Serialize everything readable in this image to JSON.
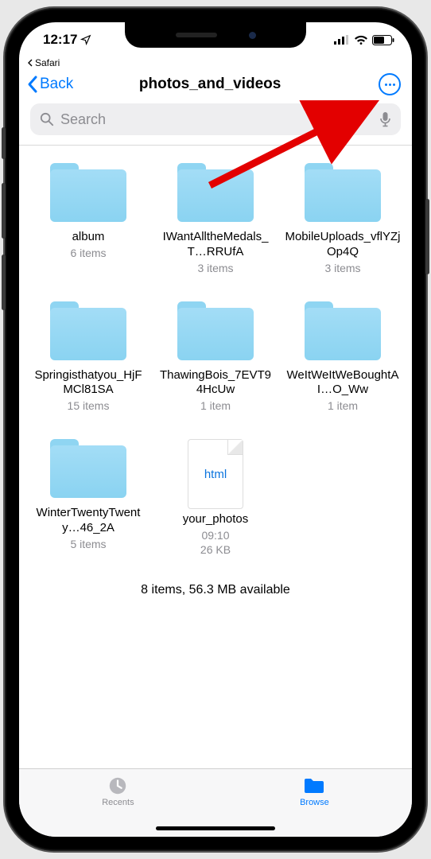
{
  "status": {
    "time": "12:17",
    "back_app": "Safari"
  },
  "nav": {
    "back_label": "Back",
    "title": "photos_and_videos"
  },
  "search": {
    "placeholder": "Search"
  },
  "items": [
    {
      "name": "album",
      "sub": "6 items",
      "type": "folder"
    },
    {
      "name": "IWantAlltheMedals_T…RRUfA",
      "sub": "3 items",
      "type": "folder"
    },
    {
      "name": "MobileUploads_vflYZjOp4Q",
      "sub": "3 items",
      "type": "folder"
    },
    {
      "name": "Springisthatyou_HjFMCl81SA",
      "sub": "15 items",
      "type": "folder"
    },
    {
      "name": "ThawingBois_7EVT94HcUw",
      "sub": "1 item",
      "type": "folder"
    },
    {
      "name": "WeItWeItWeBoughtAI…O_Ww",
      "sub": "1 item",
      "type": "folder"
    },
    {
      "name": "WinterTwentyTwenty…46_2A",
      "sub": "5 items",
      "type": "folder"
    },
    {
      "name": "your_photos",
      "sub": "09:10",
      "sub2": "26 KB",
      "type": "file",
      "badge": "html"
    }
  ],
  "summary": "8 items, 56.3 MB available",
  "tabs": {
    "recents": "Recents",
    "browse": "Browse"
  }
}
